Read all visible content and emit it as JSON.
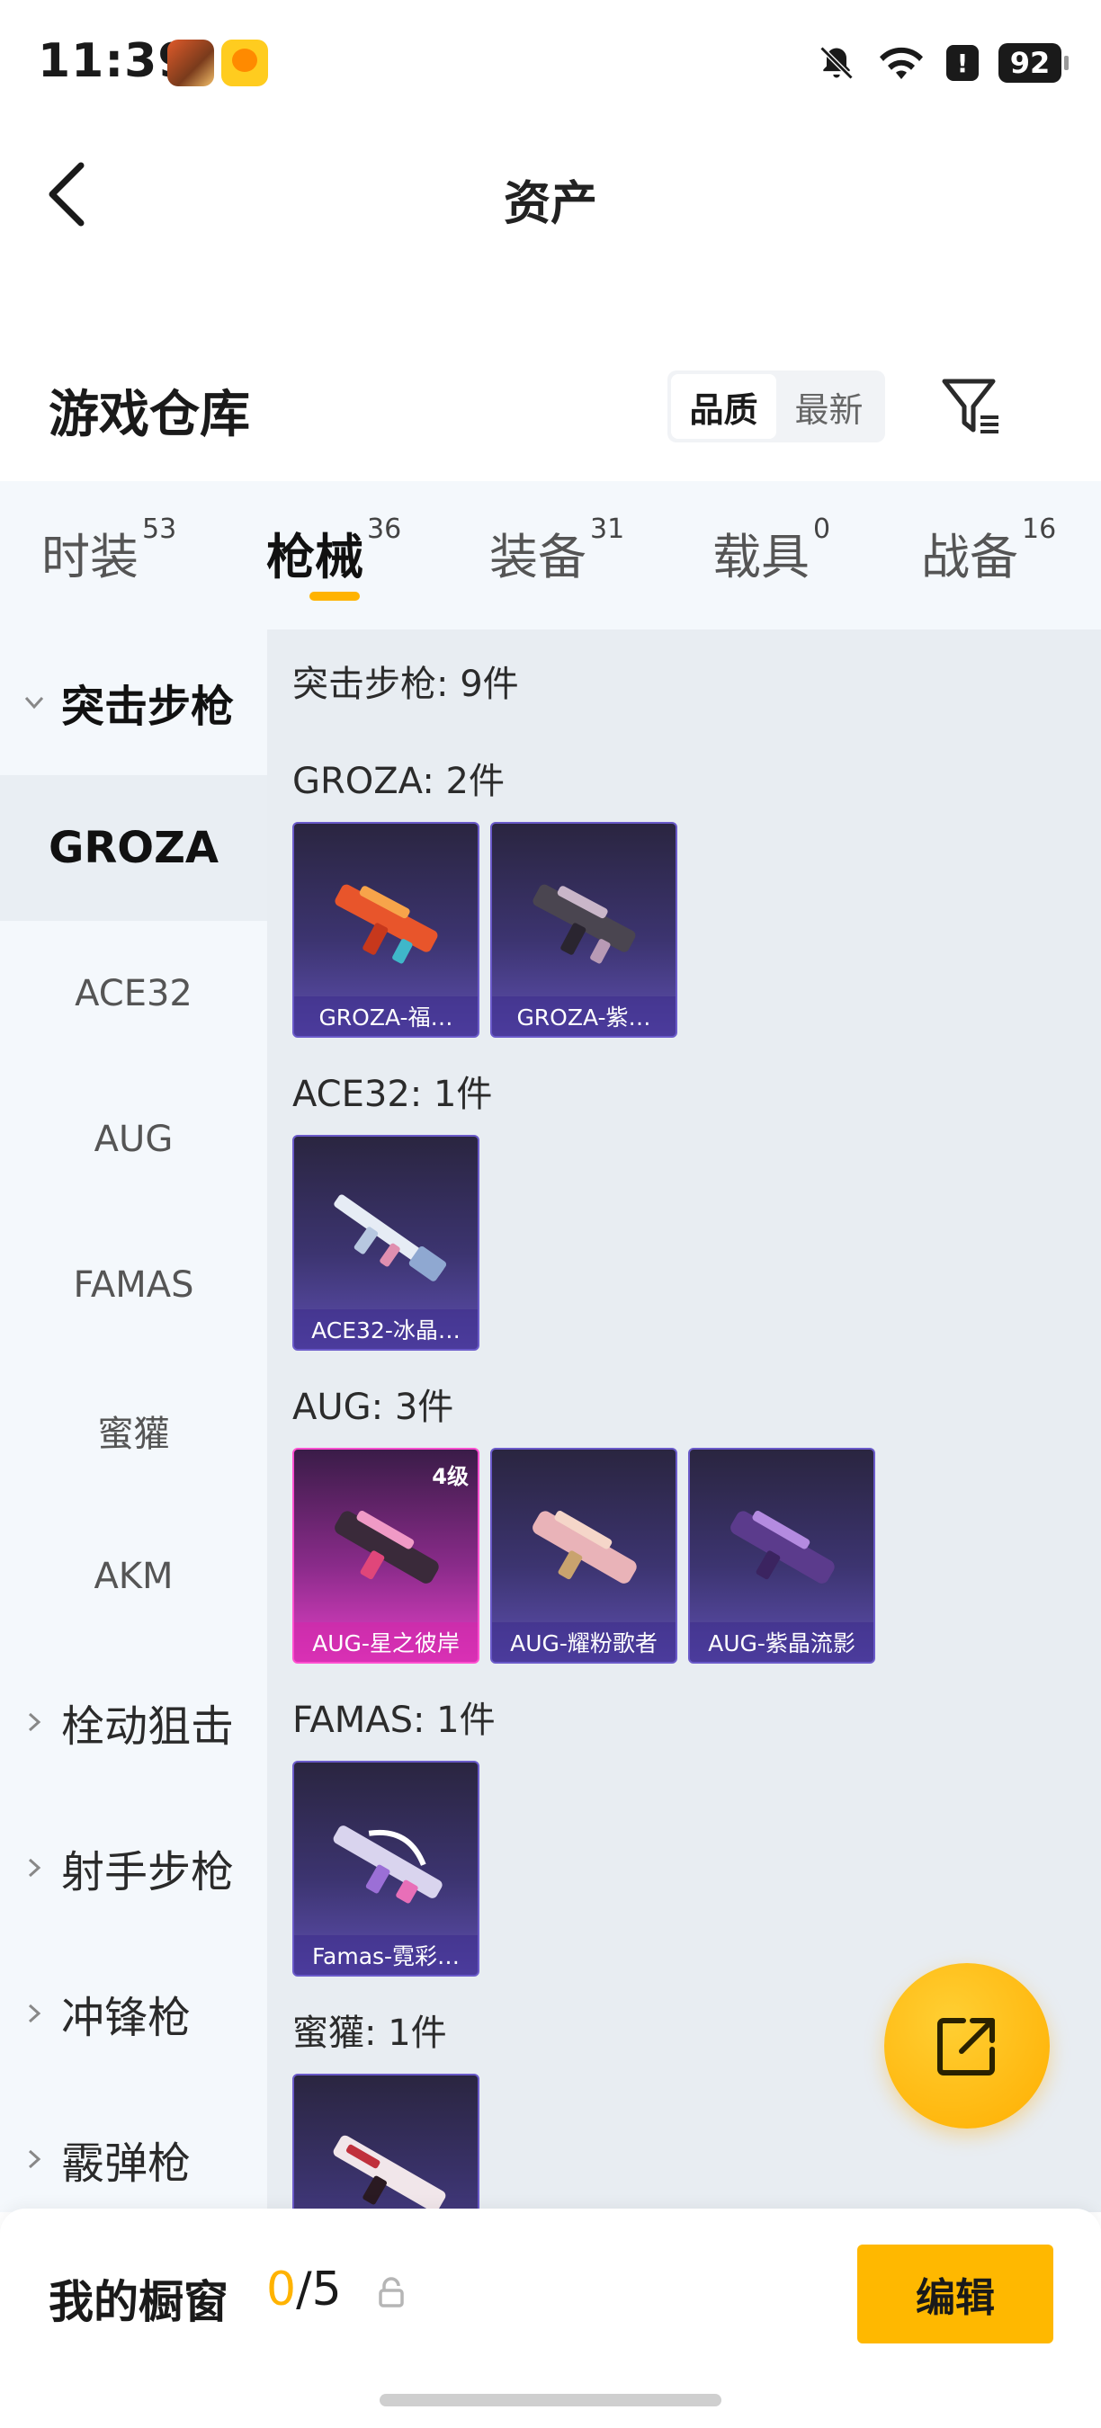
{
  "status_bar": {
    "time": "11:39",
    "battery": "92",
    "alert": "!"
  },
  "nav": {
    "title": "资产"
  },
  "section": {
    "title": "游戏仓库",
    "sort_options": [
      {
        "label": "品质",
        "active": true
      },
      {
        "label": "最新",
        "active": false
      }
    ]
  },
  "tabs": [
    {
      "label": "时装",
      "count": "53"
    },
    {
      "label": "枪械",
      "count": "36"
    },
    {
      "label": "装备",
      "count": "31"
    },
    {
      "label": "载具",
      "count": "0"
    },
    {
      "label": "战备",
      "count": "16"
    }
  ],
  "sidebar": {
    "groups": [
      {
        "label": "突击步枪",
        "open": true
      },
      {
        "label": "栓动狙击"
      },
      {
        "label": "射手步枪"
      },
      {
        "label": "冲锋枪"
      },
      {
        "label": "霰弹枪"
      }
    ],
    "items": [
      "GROZA",
      "ACE32",
      "AUG",
      "FAMAS",
      "蜜獾",
      "AKM"
    ]
  },
  "content": {
    "header": "突击步枪: 9件",
    "groups": [
      {
        "title": "GROZA: 2件",
        "items": [
          {
            "name": "GROZA-福…"
          },
          {
            "name": "GROZA-紫…"
          }
        ]
      },
      {
        "title": "ACE32: 1件",
        "items": [
          {
            "name": "ACE32-冰晶…"
          }
        ]
      },
      {
        "title": "AUG: 3件",
        "items": [
          {
            "name": "AUG-星之彼岸",
            "level": "4级"
          },
          {
            "name": "AUG-耀粉歌者"
          },
          {
            "name": "AUG-紫晶流影"
          }
        ]
      },
      {
        "title": "FAMAS: 1件",
        "items": [
          {
            "name": "Famas-霓彩…"
          }
        ]
      },
      {
        "title": "蜜獾: 1件",
        "items": []
      }
    ]
  },
  "showcase": {
    "title": "我的橱窗",
    "current": "0",
    "total": "/5",
    "edit_label": "编辑"
  },
  "colors": {
    "accent": "#ffb300",
    "legendary": "#e540c7",
    "epic": "#5e4fb0"
  }
}
